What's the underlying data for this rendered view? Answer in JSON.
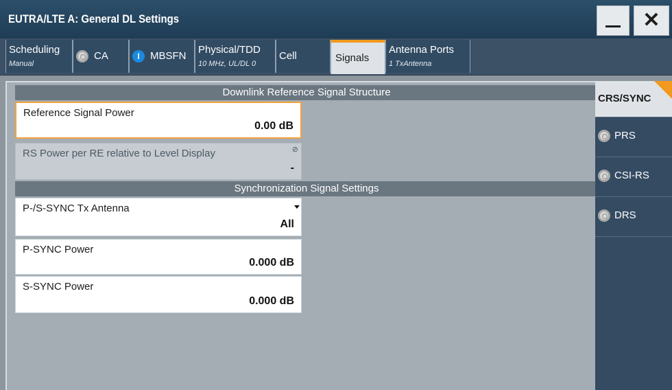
{
  "window": {
    "title": "EUTRA/LTE A: General DL Settings",
    "minimize_icon": "minimize-icon",
    "close_icon": "close-icon",
    "close_glyph": "✕"
  },
  "tabs": [
    {
      "label": "Scheduling",
      "sub": "Manual"
    },
    {
      "label": "CA",
      "indicator": "off"
    },
    {
      "label": "MBSFN",
      "indicator": "on",
      "indicator_glyph": "I"
    },
    {
      "label": "Physical/TDD",
      "sub": "10 MHz, UL/DL 0"
    },
    {
      "label": "Cell"
    },
    {
      "label": "Signals",
      "active": true
    },
    {
      "label": "Antenna Ports",
      "sub": "1 TxAntenna"
    }
  ],
  "sections": {
    "dl_ref": "Downlink Reference Signal Structure",
    "sync": "Synchronization Signal Settings"
  },
  "fields": {
    "ref_signal_power": {
      "label": "Reference Signal Power",
      "value": "0.00 dB"
    },
    "rs_power_per_re": {
      "label": "RS Power per RE relative to Level Display",
      "value": "-",
      "lock_glyph": "⊘"
    },
    "psync_tx_antenna": {
      "label": "P-/S-SYNC Tx Antenna",
      "value": "All"
    },
    "psync_power": {
      "label": "P-SYNC Power",
      "value": "0.000 dB"
    },
    "ssync_power": {
      "label": "S-SYNC Power",
      "value": "0.000 dB"
    }
  },
  "side_tabs": [
    {
      "label": "CRS/SYNC",
      "active": true
    },
    {
      "label": "PRS",
      "indicator": "off"
    },
    {
      "label": "CSI-RS",
      "indicator": "off"
    },
    {
      "label": "DRS",
      "indicator": "off"
    }
  ],
  "colors": {
    "accent": "#f39a1e",
    "info": "#1a8be0"
  }
}
